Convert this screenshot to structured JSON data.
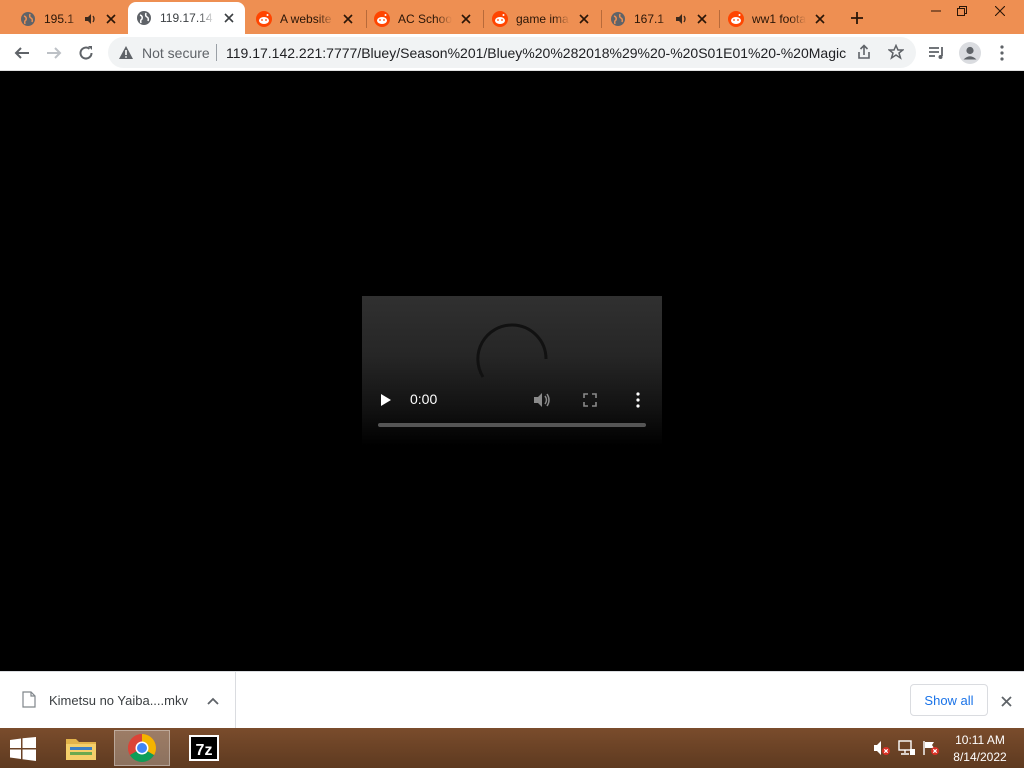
{
  "tabs": [
    {
      "title": "195.1",
      "favicon": "globe-icon",
      "audio": true,
      "active": false
    },
    {
      "title": "119.17.14",
      "favicon": "globe-icon",
      "audio": false,
      "active": true
    },
    {
      "title": "A website",
      "favicon": "reddit-icon",
      "audio": false,
      "active": false
    },
    {
      "title": "AC Schoo",
      "favicon": "reddit-icon",
      "audio": false,
      "active": false
    },
    {
      "title": "game ima",
      "favicon": "reddit-icon",
      "audio": false,
      "active": false
    },
    {
      "title": "167.1",
      "favicon": "globe-icon",
      "audio": true,
      "active": false
    },
    {
      "title": "ww1 foota",
      "favicon": "reddit-icon",
      "audio": false,
      "active": false
    }
  ],
  "omnibox": {
    "security_label": "Not secure",
    "url": "119.17.142.221:7777/Bluey/Season%201/Bluey%20%282018%29%20-%20S01E01%20-%20Magic%..."
  },
  "player": {
    "time": "0:00",
    "progress": 0
  },
  "download_shelf": {
    "file_name": "Kimetsu no Yaiba....mkv",
    "show_all_label": "Show all"
  },
  "taskbar": {
    "apps": [
      "file-explorer",
      "chrome",
      "7zip"
    ],
    "app_7zip_label": "7z",
    "time": "10:11 AM",
    "date": "8/14/2022"
  },
  "colors": {
    "tabstrip": "#ee8f52",
    "taskbar": "#6b4226",
    "link_blue": "#1a73e8"
  }
}
